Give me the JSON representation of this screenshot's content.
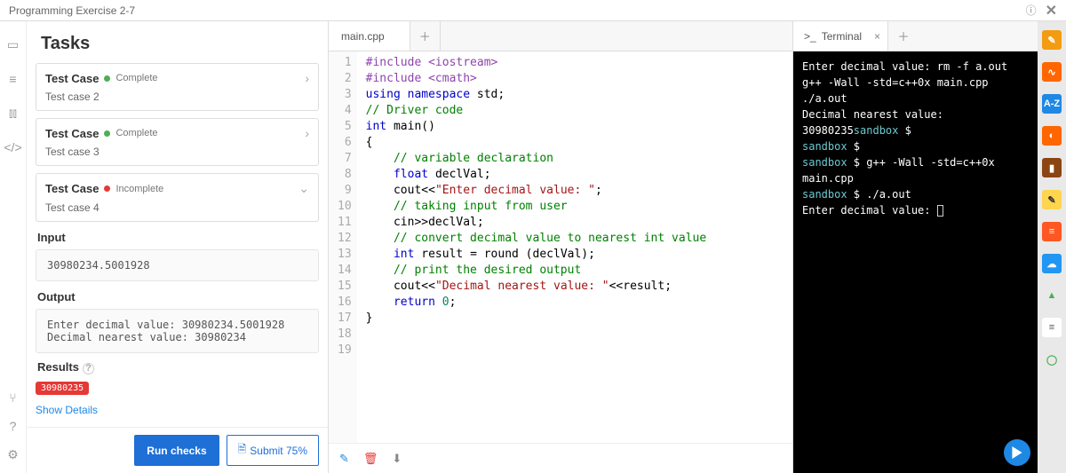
{
  "topbar": {
    "title": "Programming Exercise 2-7"
  },
  "tasks": {
    "header": "Tasks",
    "cases": [
      {
        "title": "Test Case",
        "status": "Complete",
        "dot": "green",
        "sub": "Test case 2",
        "chev": "›"
      },
      {
        "title": "Test Case",
        "status": "Complete",
        "dot": "green",
        "sub": "Test case 3",
        "chev": "›"
      },
      {
        "title": "Test Case",
        "status": "Incomplete",
        "dot": "red",
        "sub": "Test case 4",
        "chev": "⌄"
      }
    ],
    "input_label": "Input",
    "input_value": "30980234.5001928",
    "output_label": "Output",
    "output_value": "Enter decimal value: 30980234.5001928\nDecimal nearest value: 30980234",
    "results_label": "Results",
    "badge": "30980235",
    "show_details": "Show Details",
    "run_checks": "Run checks",
    "submit": "Submit 75%"
  },
  "editor": {
    "tab": "main.cpp",
    "lines": [
      [
        {
          "c": "kw-pre",
          "t": "#include <iostream>"
        }
      ],
      [
        {
          "c": "kw-pre",
          "t": "#include <cmath>"
        }
      ],
      [
        {
          "c": "kw-blue",
          "t": "using namespace "
        },
        {
          "c": "kw-black",
          "t": "std;"
        }
      ],
      [
        {
          "c": "kw-green",
          "t": "// Driver code"
        }
      ],
      [
        {
          "c": "kw-blue",
          "t": "int "
        },
        {
          "c": "kw-black",
          "t": "main()"
        }
      ],
      [
        {
          "c": "kw-black",
          "t": "{"
        }
      ],
      [
        {
          "c": "kw-black",
          "t": "    "
        },
        {
          "c": "kw-green",
          "t": "// variable declaration"
        }
      ],
      [
        {
          "c": "kw-black",
          "t": "    "
        },
        {
          "c": "kw-blue",
          "t": "float "
        },
        {
          "c": "kw-black",
          "t": "declVal;"
        }
      ],
      [
        {
          "c": "kw-black",
          "t": "    cout<<"
        },
        {
          "c": "str",
          "t": "\"Enter decimal value: \""
        },
        {
          "c": "kw-black",
          "t": ";"
        }
      ],
      [
        {
          "c": "kw-black",
          "t": "    "
        },
        {
          "c": "kw-green",
          "t": "// taking input from user"
        }
      ],
      [
        {
          "c": "kw-black",
          "t": "    cin>>declVal;"
        }
      ],
      [
        {
          "c": "kw-black",
          "t": "    "
        },
        {
          "c": "kw-green",
          "t": "// convert decimal value to nearest int value"
        }
      ],
      [
        {
          "c": "kw-black",
          "t": "    "
        },
        {
          "c": "kw-blue",
          "t": "int "
        },
        {
          "c": "kw-black",
          "t": "result = round (declVal);"
        }
      ],
      [
        {
          "c": "kw-black",
          "t": "    "
        },
        {
          "c": "kw-green",
          "t": "// print the desired output"
        }
      ],
      [
        {
          "c": "kw-black",
          "t": "    cout<<"
        },
        {
          "c": "str",
          "t": "\"Decimal nearest value: \""
        },
        {
          "c": "kw-black",
          "t": "<<result;"
        }
      ],
      [
        {
          "c": "kw-black",
          "t": ""
        }
      ],
      [
        {
          "c": "kw-black",
          "t": "    "
        },
        {
          "c": "kw-blue",
          "t": "return "
        },
        {
          "c": "num",
          "t": "0"
        },
        {
          "c": "kw-black",
          "t": ";"
        }
      ],
      [
        {
          "c": "kw-black",
          "t": "}"
        }
      ],
      [
        {
          "c": "kw-black",
          "t": ""
        }
      ]
    ]
  },
  "terminal": {
    "tab": "Terminal",
    "lines": [
      [
        {
          "c": "t-white",
          "t": "Enter decimal value: rm -f a.out"
        }
      ],
      [
        {
          "c": "",
          "t": ""
        }
      ],
      [
        {
          "c": "",
          "t": ""
        }
      ],
      [
        {
          "c": "t-white",
          "t": "g++ -Wall -std=c++0x main.cpp"
        }
      ],
      [
        {
          "c": "t-white",
          "t": "./a.out"
        }
      ],
      [
        {
          "c": "t-white",
          "t": "Decimal nearest value: 30980235"
        },
        {
          "c": "t-cyan",
          "t": "sandbox"
        },
        {
          "c": "t-white",
          "t": " $"
        }
      ],
      [
        {
          "c": "t-cyan",
          "t": "sandbox"
        },
        {
          "c": "t-white",
          "t": " $"
        }
      ],
      [
        {
          "c": "t-cyan",
          "t": "sandbox"
        },
        {
          "c": "t-white",
          "t": " $ g++ -Wall -std=c++0x main.cpp"
        }
      ],
      [
        {
          "c": "t-cyan",
          "t": "sandbox"
        },
        {
          "c": "t-white",
          "t": " $ ./a.out"
        }
      ],
      [
        {
          "c": "t-white",
          "t": "Enter decimal value: "
        }
      ]
    ]
  },
  "rightbar": {
    "items": [
      {
        "bg": "#f39c12",
        "fg": "#fff",
        "t": "✎"
      },
      {
        "bg": "#ff6600",
        "fg": "#fff",
        "t": "∿"
      },
      {
        "bg": "#1e88e5",
        "fg": "#fff",
        "t": "A-Z"
      },
      {
        "bg": "#ff6600",
        "fg": "#fff",
        "t": "◐"
      },
      {
        "bg": "#8b4513",
        "fg": "#fff",
        "t": "▮"
      },
      {
        "bg": "#ffd54f",
        "fg": "#333",
        "t": "✎"
      },
      {
        "bg": "#ff5722",
        "fg": "#fff",
        "t": "≡"
      },
      {
        "bg": "#2196f3",
        "fg": "#fff",
        "t": "☁"
      },
      {
        "bg": "transparent",
        "fg": "#4caf50",
        "t": "▲"
      },
      {
        "bg": "#fff",
        "fg": "#555",
        "t": "≡"
      },
      {
        "bg": "transparent",
        "fg": "#4caf50",
        "t": "◯"
      }
    ]
  }
}
